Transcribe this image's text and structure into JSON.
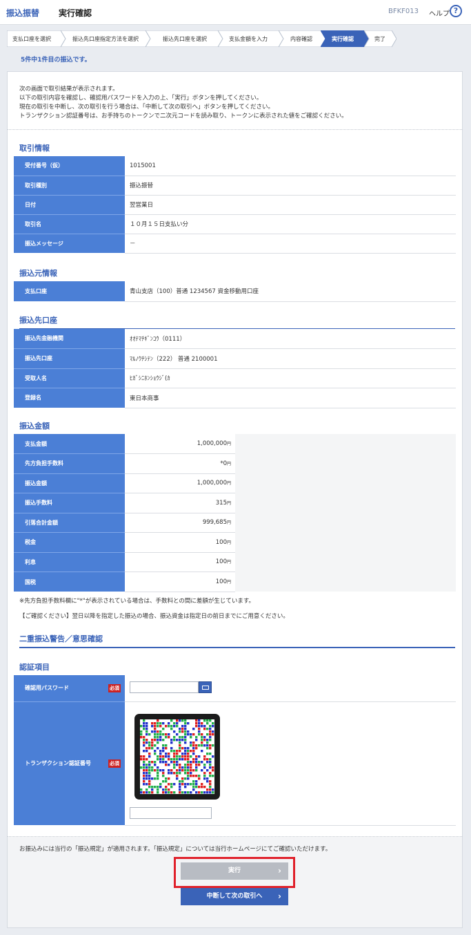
{
  "header": {
    "app_title": "振込振替",
    "page_title": "実行確認",
    "screen_id": "BFKF013",
    "help_label": "ヘルプ",
    "help_icon": "question-circle-icon"
  },
  "steps": [
    {
      "label": "支払口座を選択"
    },
    {
      "label": "振込先口座指定方法を選択"
    },
    {
      "label": "振込先口座を選択"
    },
    {
      "label": "支払金額を入力"
    },
    {
      "label": "内容確認"
    },
    {
      "label": "実行確認"
    },
    {
      "label": "完了"
    }
  ],
  "count_message": "5件中1件目の振込です。",
  "intro": [
    "次の画面で取引結果が表示されます。",
    "以下の取引内容を確認し、確認用パスワードを入力の上、「実行」ボタンを押してください。",
    "現在の取引を中断し、次の取引を行う場合は、「中断して次の取引へ」ボタンを押してください。",
    "トランザクション認証番号は、お手持ちのトークンで二次元コードを読み取り、トークンに表示された値をご確認ください。"
  ],
  "transaction": {
    "heading": "取引情報",
    "rows": [
      {
        "label": "受付番号（仮）",
        "value": "1015001"
      },
      {
        "label": "取引種別",
        "value": "振込振替"
      },
      {
        "label": "日付",
        "value": "翌営業日"
      },
      {
        "label": "取引名",
        "value": "１０月１５日支払い分"
      },
      {
        "label": "振込メッセージ",
        "value": "－"
      }
    ]
  },
  "source": {
    "heading": "振込元情報",
    "rows": [
      {
        "label": "支払口座",
        "value": "青山支店（100）普通 1234567 資金移動用口座"
      }
    ]
  },
  "destination": {
    "heading": "振込先口座",
    "rows": [
      {
        "label": "振込先金融機関",
        "value": "ｵｵﾃﾏﾁｷﾞﾝｺｳ（0111）"
      },
      {
        "label": "振込先口座",
        "value": "ﾏﾙﾉｳﾁｼﾃﾝ（222） 普通 2100001"
      },
      {
        "label": "受取人名",
        "value": "ﾋｶﾞｼﾆﾎﾝｼｮｳｼﾞ(ｶ"
      },
      {
        "label": "登録名",
        "value": "東日本商事"
      }
    ]
  },
  "amounts": {
    "heading": "振込金額",
    "unit": "円",
    "rows": [
      {
        "label": "支払金額",
        "value": "1,000,000"
      },
      {
        "label": "先方負担手数料",
        "value": "*0"
      },
      {
        "label": "振込金額",
        "value": "1,000,000"
      },
      {
        "label": "振込手数料",
        "value": "315"
      },
      {
        "label": "引落合計金額",
        "value": "999,685"
      },
      {
        "label": "税金",
        "value": "100"
      },
      {
        "label": "利息",
        "value": "100"
      },
      {
        "label": "国税",
        "value": "100"
      }
    ],
    "note1": "※先方負担手数料欄に\"*\"が表示されている場合は、手数料との間に差額が生じています。",
    "note2": "【ご確認ください】翌日以降を指定した振込の場合、振込資金は指定日の前日までにご用意ください。"
  },
  "double_warning": {
    "heading": "二重振込警告／意思確認"
  },
  "auth": {
    "heading": "認証項目",
    "password_label": "確認用パスワード",
    "required_badge": "必須",
    "keyboard_icon": "software-keyboard-icon",
    "token_label": "トランザクション認証番号",
    "qr_icon": "qr-code-icon"
  },
  "footer": {
    "rule_text": "お振込みには当行の「振込規定」が適用されます。「振込規定」については当行ホームページにてご確認いただけます。",
    "execute_label": "実行",
    "suspend_label": "中断して次の取引へ",
    "chevron_icon": "chevron-right-icon"
  }
}
